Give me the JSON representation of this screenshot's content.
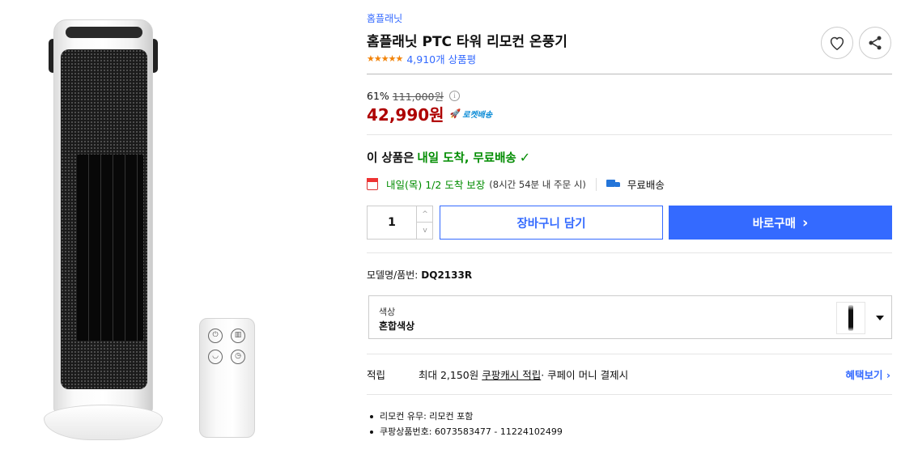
{
  "product": {
    "brand": "홈플래닛",
    "title": "홈플래닛 PTC 타워 리모컨 온풍기",
    "rating_stars": 4.5,
    "review_count": "4,910개 상품평"
  },
  "icons": {
    "wishlist": "heart-icon",
    "share": "share-icon",
    "info": "info-icon",
    "rocket": "rocket-icon",
    "calendar": "calendar-icon",
    "truck": "truck-icon",
    "check": "check-icon"
  },
  "price": {
    "discount_rate": "61%",
    "original_price": "111,000원",
    "sale_price": "42,990원",
    "rocket_badge": "로켓배송"
  },
  "arrival": {
    "prefix": "이 상품은",
    "highlight": "내일 도착, 무료배송",
    "check_glyph": "✓"
  },
  "delivery": {
    "date_text": "내일(목) 1/2 도착 보장",
    "deadline": "(8시간 54분 내 주문 시)",
    "free_shipping": "무료배송"
  },
  "purchase": {
    "quantity": "1",
    "up_glyph": "^",
    "down_glyph": "v",
    "cart_label": "장바구니 담기",
    "buy_label": "바로구매",
    "buy_chevron": "›"
  },
  "model": {
    "label": "모델명/품번:",
    "value": "DQ2133R"
  },
  "option": {
    "label": "색상",
    "value": "혼합색상"
  },
  "points": {
    "label": "적립",
    "prefix": "최대 2,150원",
    "link": "쿠팡캐시 적립",
    "suffix": " · 쿠페이 머니 결제시",
    "benefit_link": "혜택보기 ›"
  },
  "specs": [
    "리모컨 유무: 리모컨 포함",
    "쿠팡상품번호: 6073583477 - 11224102499"
  ],
  "colors": {
    "accent_blue": "#346aff",
    "sale_red": "#ae0000",
    "arrival_green": "#008c00",
    "star_orange": "#f28308",
    "rocket_blue": "#0a8bd6"
  }
}
